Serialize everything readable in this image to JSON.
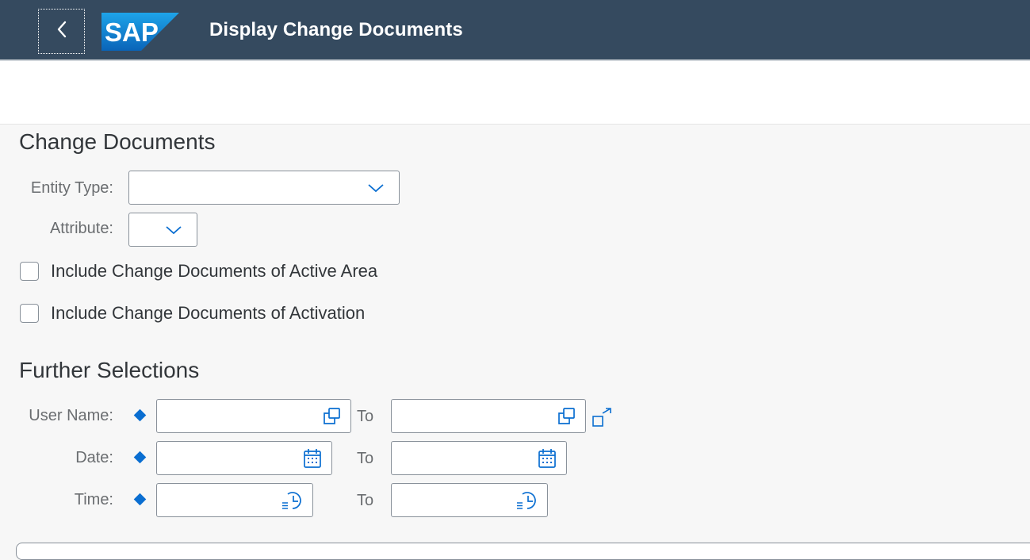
{
  "header": {
    "app_title": "Display Change Documents",
    "logo_text": "SAP",
    "back_icon": "chevron-left-icon"
  },
  "colors": {
    "shell_bg": "#354a5f",
    "accent": "#0a6ed1",
    "logo_blue": "#0a73c4"
  },
  "change_documents": {
    "section_title": "Change Documents",
    "entity_type_label": "Entity Type:",
    "entity_type_value": "",
    "attribute_label": "Attribute:",
    "attribute_value": "",
    "cb_active_area_label": "Include Change Documents of Active Area",
    "cb_activation_label": "Include Change Documents of Activation"
  },
  "further_selections": {
    "section_title": "Further Selections",
    "user_name_label": "User Name:",
    "date_label": "Date:",
    "time_label": "Time:",
    "to_label": "To",
    "user_name_from": "",
    "user_name_to": "",
    "date_from": "",
    "date_to": "",
    "time_from": "",
    "time_to": ""
  }
}
